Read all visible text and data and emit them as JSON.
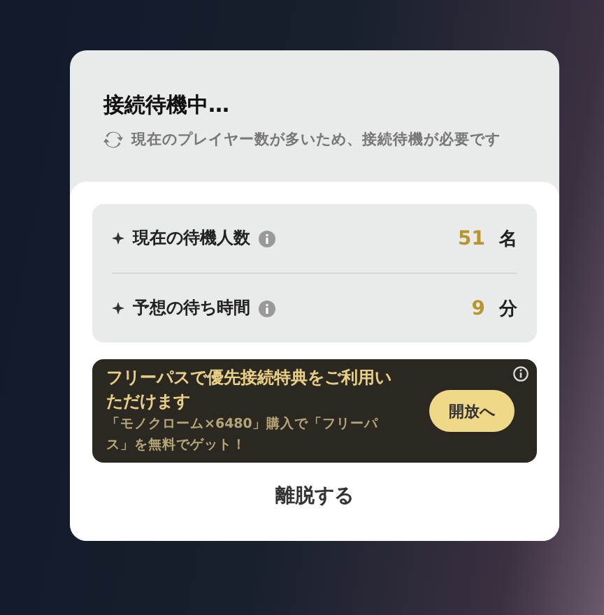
{
  "dialog": {
    "title": "接続待機中…",
    "subtitle": "現在のプレイヤー数が多いため、接続待機が必要です"
  },
  "stats": [
    {
      "label": "現在の待機人数",
      "value": "51",
      "unit": "名"
    },
    {
      "label": "予想の待ち時間",
      "value": "9",
      "unit": "分"
    }
  ],
  "promo": {
    "title": "フリーパスで優先接続特典をご利用いただけます",
    "description": "「モノクローム×6480」購入で「フリーパス」を無料でゲット！",
    "button": "開放へ"
  },
  "leave_button": "離脱する"
}
